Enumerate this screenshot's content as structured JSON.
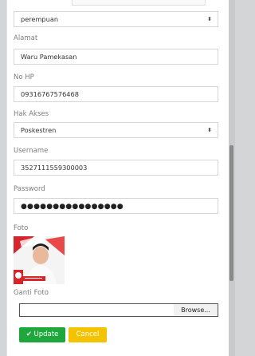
{
  "form": {
    "gender_value": "perempuan",
    "alamat_label": "Alamat",
    "alamat_value": "Waru Pamekasan",
    "nohp_label": "No HP",
    "nohp_value": "09316767576468",
    "hak_akses_label": "Hak Akses",
    "hak_akses_value": "Poskestren",
    "username_label": "Username",
    "username_value": "3527111559300003",
    "password_label": "Password",
    "password_value": "●●●●●●●●●●●●●●●●",
    "foto_label": "Foto",
    "ganti_foto_label": "Ganti Foto",
    "browse_label": "Browse..."
  },
  "actions": {
    "update_label": "Update",
    "cancel_label": "Cancel"
  },
  "icons": {
    "select_arrow": "updown-caret-icon",
    "update": "check-icon"
  },
  "colors": {
    "update": "#1ea73a",
    "cancel": "#f3c300",
    "background": "#d4d5d7"
  }
}
